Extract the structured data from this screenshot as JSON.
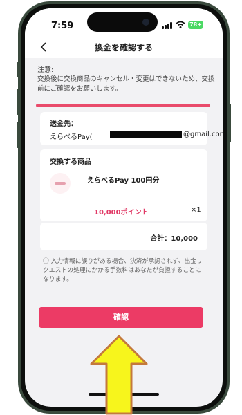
{
  "status_bar": {
    "time": "7:59",
    "battery": "78+"
  },
  "nav": {
    "title": "換金を確認する",
    "back_icon": "chevron-left-icon"
  },
  "notice": {
    "label": "注意:",
    "text": "交換後に交換商品のキャンセル・変更はできないため、交換前にご確認をお願いします。",
    "highlight_color": "#e94b6b"
  },
  "recipient": {
    "label": "送金先：",
    "prefix": "えらべるPay(",
    "suffix": "@gmail.com)"
  },
  "item": {
    "section_label": "交換する商品",
    "name": "えらべるPay 100円分",
    "points": "10,000ポイント",
    "quantity": "×1",
    "points_color": "#e13a66"
  },
  "total": {
    "text": "合計：10,000"
  },
  "footnote": {
    "text": "ⓘ 入力情報に誤りがある場合、決済が承認されず、出金リクエストの処理にかかる手数料はあなたが負担することになります。"
  },
  "confirm_button": {
    "label": "確認",
    "color": "#ec3b65"
  },
  "annotation": {
    "arrow_color": "#f7f51c",
    "arrow_outline": "#c4793c"
  }
}
